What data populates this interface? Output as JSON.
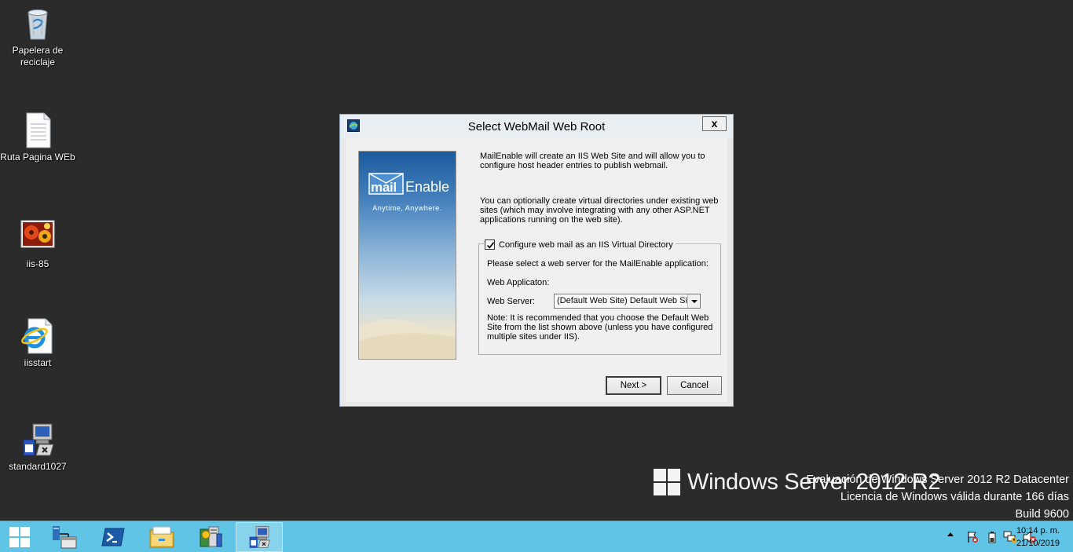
{
  "desktop": {
    "icons": [
      {
        "label": "Papelera de reciclaje",
        "icon": "recycle-bin-icon"
      },
      {
        "label": "Ruta Pagina WEb",
        "icon": "text-file-icon"
      },
      {
        "label": "iis-85",
        "icon": "image-file-icon"
      },
      {
        "label": "iisstart",
        "icon": "internet-explorer-icon"
      },
      {
        "label": "standard1027",
        "icon": "installer-icon"
      }
    ]
  },
  "watermark": {
    "logo_text": "Windows Server 2012 R2",
    "line1": "Evaluación de Windows Server 2012 R2 Datacenter",
    "line2": "Licencia de Windows válida durante 166 días",
    "line3": "Build 9600"
  },
  "dialog": {
    "title": "Select WebMail Web Root",
    "close_label": "x",
    "banner": {
      "brand_mail": "mail",
      "brand_enable": "Enable",
      "tagline": "Anytime, Anywhere."
    },
    "intro1": "MailEnable will create an IIS Web Site and will allow you to configure host header entries to publish webmail.",
    "intro2": "You can optionally create virtual directories under existing web sites (which may involve integrating with any other ASP.NET applications running on the web site).",
    "group": {
      "checkbox_label": "Configure web mail as an IIS Virtual Directory",
      "checked": true,
      "prompt": "Please select a web server for the MailEnable application:",
      "web_app_label": "Web Applicaton:",
      "web_server_label": "Web Server:",
      "web_server_value": "(Default Web Site) Default Web Site",
      "note": "Note: It is recommended that you choose the Default Web Site from the list shown above (unless you have configured multiple sites under IIS)."
    },
    "next_label": "Next >",
    "cancel_label": "Cancel"
  },
  "taskbar": {
    "buttons": [
      "start-icon",
      "server-manager-icon",
      "powershell-icon",
      "file-explorer-icon",
      "setup-icon",
      "installer-icon"
    ],
    "clock_time": "10:14 p. m.",
    "clock_date": "21/10/2019"
  },
  "colors": {
    "desktop": "#2b2b2b",
    "taskbar": "#5fc4e6",
    "dialog_frame": "#e8e8e8"
  }
}
